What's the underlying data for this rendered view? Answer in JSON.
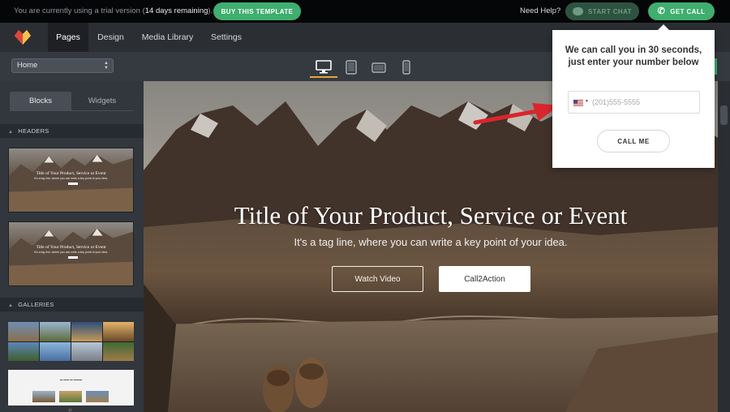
{
  "trialbar": {
    "text_prefix": "You are currently using a trial version (",
    "text_days": "14 days remaining",
    "text_suffix": ").",
    "buy_label": "BUY THIS TEMPLATE",
    "need_help": "Need Help?",
    "chat_label": "START CHAT",
    "call_label": "GET CALL"
  },
  "nav": {
    "tabs": [
      {
        "label": "Pages",
        "active": true
      },
      {
        "label": "Design",
        "active": false
      },
      {
        "label": "Media Library",
        "active": false
      },
      {
        "label": "Settings",
        "active": false
      }
    ]
  },
  "toolbar": {
    "page_select": "Home",
    "devices": [
      "desktop-icon",
      "tablet-icon",
      "tablet-landscape-icon",
      "phone-icon"
    ],
    "active_device": "desktop-icon"
  },
  "sidebar": {
    "tabs": [
      {
        "label": "Blocks",
        "active": true
      },
      {
        "label": "Widgets",
        "active": false
      }
    ],
    "sections": [
      "HEADERS",
      "GALLERIES"
    ],
    "header_thumb_title": "Title of Your Product, Service or Event",
    "header_thumb_tag": "It's a tag line, where you can write a key point of your idea."
  },
  "hero": {
    "title": "Title of Your Product, Service or Event",
    "tagline": "It's a tag line, where you can write a key point of your idea.",
    "secondary_button": "Watch Video",
    "primary_button": "Call2Action"
  },
  "callback_popup": {
    "title": "We can call you in 30 seconds, just enter your number below",
    "phone_placeholder": "(201)555-5555",
    "button_label": "CALL ME"
  },
  "colors": {
    "accent_green": "#3fae6e",
    "active_tab_underline": "#e9a63a",
    "arrow_red": "#d9262c"
  }
}
